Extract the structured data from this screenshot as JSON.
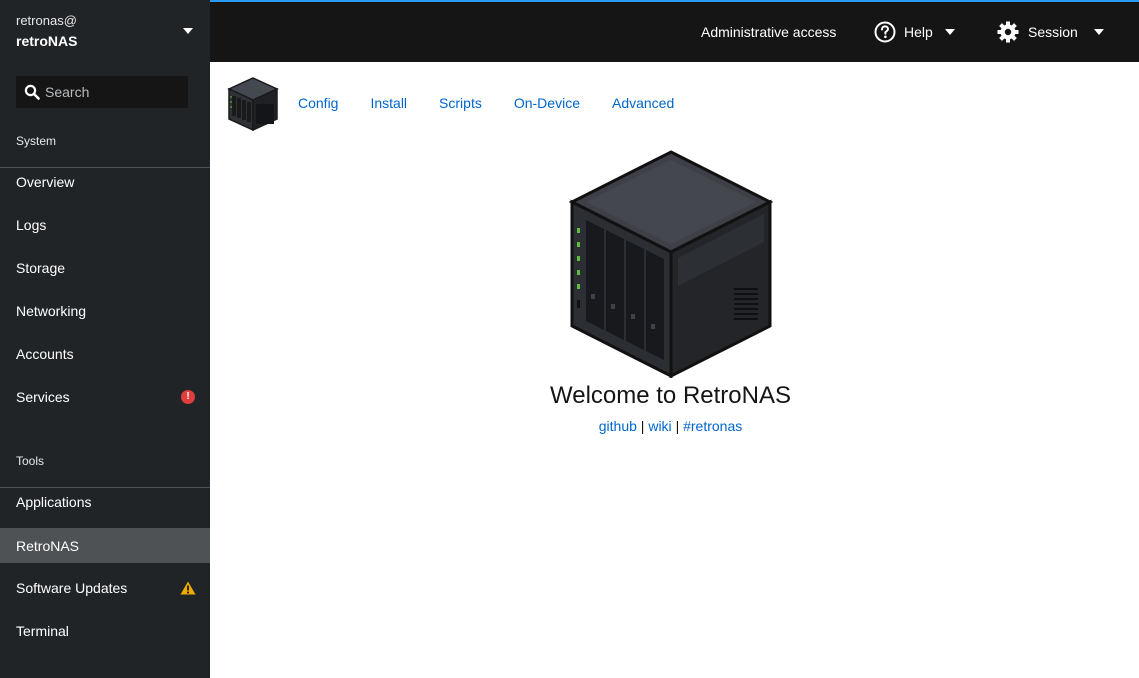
{
  "host": {
    "user": "retronas@",
    "name": "retroNAS"
  },
  "search": {
    "placeholder": "Search"
  },
  "sidebar": {
    "system_title": "System",
    "system_items": [
      {
        "label": "Overview"
      },
      {
        "label": "Logs"
      },
      {
        "label": "Storage"
      },
      {
        "label": "Networking"
      },
      {
        "label": "Accounts"
      },
      {
        "label": "Services",
        "badge": "!"
      }
    ],
    "tools_title": "Tools",
    "tools_items": [
      {
        "label": "Applications"
      },
      {
        "label": "RetroNAS",
        "active": true
      },
      {
        "label": "Software Updates",
        "badge": "warning"
      },
      {
        "label": "Terminal"
      }
    ]
  },
  "topbar": {
    "admin": "Administrative access",
    "help": "Help",
    "session": "Session"
  },
  "tabs": [
    "Config",
    "Install",
    "Scripts",
    "On-Device",
    "Advanced"
  ],
  "welcome": {
    "title": "Welcome to RetroNAS",
    "links": [
      "github",
      "wiki",
      "#retronas"
    ],
    "separator": "|"
  },
  "colors": {
    "accent": "#2b9af3",
    "link": "#0066cc",
    "sidebar": "#212427",
    "topbar": "#151515",
    "error": "#e03e3e",
    "warning": "#f0ab00"
  }
}
